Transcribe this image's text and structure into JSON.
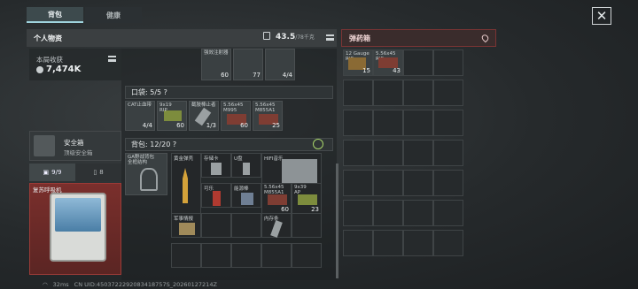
{
  "tabs": {
    "backpack": "背包",
    "health": "健康"
  },
  "personal": {
    "title": "个人物资",
    "weight": "43.5",
    "weight_max": "/78千克"
  },
  "ammo_box": {
    "title": "弹药箱"
  },
  "income": {
    "label": "本局收获",
    "value": "7,474K"
  },
  "safe": {
    "name": "安全箱",
    "sub": "顶级安全箱"
  },
  "slots": {
    "a": "9/9",
    "b": "8"
  },
  "device": {
    "label": "复苏呼吸机"
  },
  "top_items": [
    {
      "name": "强效注射器",
      "count": "60"
    },
    {
      "name": "",
      "count": "77"
    },
    {
      "name": "",
      "count": "4/4"
    }
  ],
  "pocket": {
    "title": "口袋: 5/5 ?",
    "items": [
      {
        "name": "CAT止血带",
        "count": "4/4"
      },
      {
        "name": "9x19\nRIP",
        "count": "60"
      },
      {
        "name": "截肢棒止者",
        "count": "1/3"
      },
      {
        "name": "5.56x45\nM995",
        "count": "60"
      },
      {
        "name": "5.56x45\nM855A1",
        "count": "25"
      }
    ]
  },
  "backpack": {
    "title": "背包: 12/20 ?",
    "items": [
      {
        "name": "GA野战背包\n全框结构",
        "count": ""
      },
      {
        "name": "黄金弹壳",
        "count": ""
      },
      {
        "name": "存储卡",
        "count": ""
      },
      {
        "name": "U盘",
        "count": ""
      },
      {
        "name": "HIFI音乐",
        "count": ""
      },
      {
        "name": "可乐",
        "count": ""
      },
      {
        "name": "能源棒",
        "count": ""
      },
      {
        "name": "5.56x45\nM855A1",
        "count": "60"
      },
      {
        "name": "9x39\nAP",
        "count": "23"
      },
      {
        "name": "军事情报",
        "count": ""
      },
      {
        "name": "内存条",
        "count": ""
      }
    ]
  },
  "ammo_items": [
    {
      "name": "12 Gauge\nRIP",
      "count": "15"
    },
    {
      "name": "5.56x45\nRIP",
      "count": "43"
    }
  ],
  "status": {
    "ping": "32ms",
    "uid": "CN UID:4503722292083418757S_20260127214Z"
  },
  "colors": {
    "accent": "#9fd3dd",
    "ammo_border": "#7a3434",
    "device_bg": "#7a2f2c"
  }
}
